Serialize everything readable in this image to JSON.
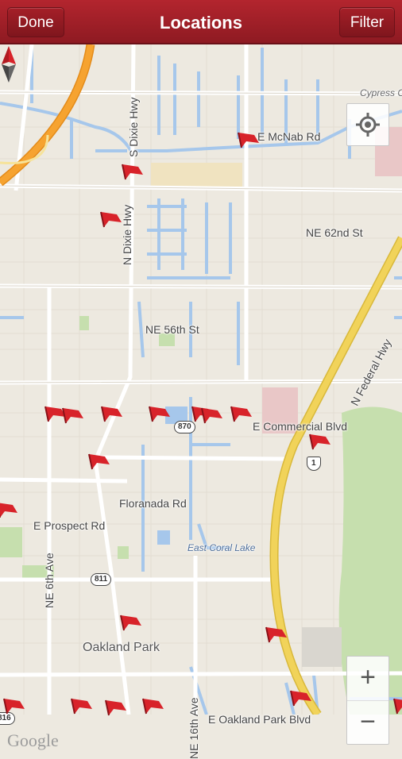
{
  "header": {
    "title": "Locations",
    "done_label": "Done",
    "filter_label": "Filter"
  },
  "map": {
    "streets": {
      "cypress": "Cypress C",
      "mcnab": "E McNab Rd",
      "ne62": "NE 62nd St",
      "ne56": "NE 56th St",
      "commercial": "E Commercial Blvd",
      "floranada": "Floranada Rd",
      "prospect": "E Prospect Rd",
      "oakland_blvd": "E Oakland Park Blvd",
      "s_dixie": "S Dixie Hwy",
      "n_dixie": "N Dixie Hwy",
      "ne6": "NE 6th Ave",
      "ne16": "NE 16th Ave",
      "federal": "N Federal Hwy"
    },
    "places": {
      "lake": "East Coral Lake",
      "oakland": "Oakland Park"
    },
    "shields": {
      "r870": "870",
      "us1": "1",
      "r811": "811",
      "r816": "816"
    },
    "attribution": "Google",
    "colors": {
      "marker": "#d8232a",
      "highway": "#f6a330",
      "federal": "#f1d35a",
      "water": "#a6c7eb",
      "land": "#ede9e0"
    }
  },
  "controls": {
    "zoom_in": "+",
    "zoom_out": "−"
  }
}
